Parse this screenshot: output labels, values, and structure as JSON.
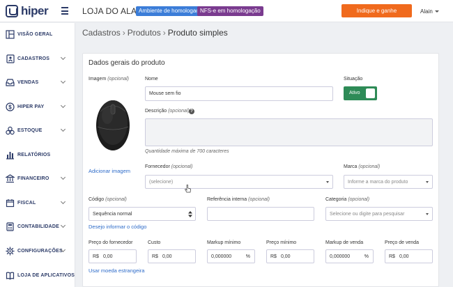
{
  "topbar": {
    "logo_text": "hiper",
    "store_name": "LOJA DO ALAIN",
    "env_badge": "Ambiente de homologação",
    "nfs_badge": "NFS-e em homologação",
    "cta_label": "Indique e ganhe",
    "user_name": "Alain"
  },
  "sidebar": {
    "items": [
      {
        "label": "VISÃO GERAL",
        "icon": "dashboard-icon"
      },
      {
        "label": "CADASTROS",
        "icon": "address-book-icon"
      },
      {
        "label": "VENDAS",
        "icon": "inbox-icon"
      },
      {
        "label": "HIPER PAY",
        "icon": "dollar-icon"
      },
      {
        "label": "ESTOQUE",
        "icon": "boxes-icon"
      },
      {
        "label": "RELATÓRIOS",
        "icon": "bar-chart-icon"
      },
      {
        "label": "FINANCEIRO",
        "icon": "bank-icon"
      },
      {
        "label": "FISCAL",
        "icon": "calendar-icon"
      },
      {
        "label": "CONTABILIDADE",
        "icon": "calculator-icon"
      },
      {
        "label": "CONFIGURAÇÕES",
        "icon": "gear-icon"
      },
      {
        "label": "LOJA DE APLICATIVOS",
        "icon": "book-icon"
      }
    ]
  },
  "breadcrumb": {
    "items": [
      "Cadastros",
      "Produtos",
      "Produto simples"
    ]
  },
  "form": {
    "section_title": "Dados gerais do produto",
    "image_label": "Imagem",
    "optional": "(opcional)",
    "add_image": "Adicionar imagem",
    "name_label": "Nome",
    "name_value": "Mouse sem fio",
    "status_label": "Situação",
    "status_value": "Ativo",
    "description_label": "Descrição",
    "description_hint": "Quantidade máxima de 700 caracteres",
    "supplier_label": "Fornecedor",
    "supplier_placeholder": "(selecione)",
    "brand_label": "Marca",
    "brand_placeholder": "Informe a marca do produto",
    "code_label": "Código",
    "code_value": "Sequência normal",
    "code_link": "Desejo informar o código",
    "ref_label": "Referência interna",
    "category_label": "Categoria",
    "category_placeholder": "Selecione ou digite para pesquisar",
    "price": {
      "supplier_label": "Preço do fornecedor",
      "cost_label": "Custo",
      "markup_min_label": "Markup mínimo",
      "min_price_label": "Preço mínimo",
      "markup_sale_label": "Markup de venda",
      "sale_price_label": "Preço de venda",
      "currency": "R$",
      "money_value": "0,00",
      "markup_value": "0,000000",
      "percent": "%"
    },
    "foreign_currency_link": "Usar moeda estrangeira"
  },
  "colors": {
    "accent": "#f06a1d",
    "brand": "#2b3a67",
    "link": "#2d6bc9",
    "active": "#2e8b57"
  }
}
